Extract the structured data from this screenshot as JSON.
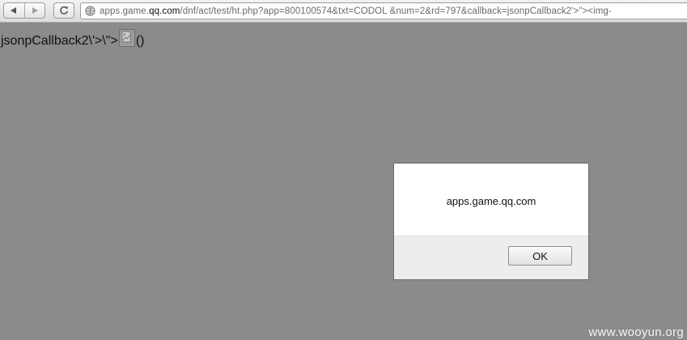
{
  "browser": {
    "url_host_prefix": "apps.game.",
    "url_host_domain": "qq.com",
    "url_path": "/dnf/act/test/ht.php?app=800100574&txt=CODOL   &num=2&rd=797&callback=jsonpCallback2'>\"><img-",
    "icons": {
      "back": "back-arrow-icon",
      "forward": "forward-arrow-icon",
      "reload": "reload-icon",
      "site": "globe-icon"
    }
  },
  "page": {
    "text_before": "jsonpCallback2\\'>\\\">",
    "text_after": "()",
    "broken_image_icon": "broken-image-icon"
  },
  "alert": {
    "message": "apps.game.qq.com",
    "ok_label": "OK"
  },
  "watermark": "www.wooyun.org",
  "colors": {
    "page_background": "#8b8b8b",
    "dialog_footer": "#ededed"
  }
}
